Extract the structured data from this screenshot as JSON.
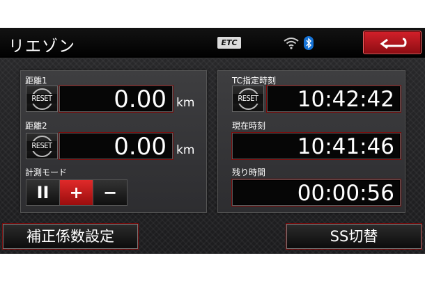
{
  "header": {
    "title": "リエゾン",
    "etc_badge": "ETC"
  },
  "left_panel": {
    "distance1": {
      "label": "距離1",
      "reset_label": "RESET",
      "value": "0.00",
      "unit": "km"
    },
    "distance2": {
      "label": "距離2",
      "reset_label": "RESET",
      "value": "0.00",
      "unit": "km"
    },
    "measure_mode": {
      "label": "計測モード",
      "buttons": [
        "II",
        "+",
        "−"
      ],
      "active": "+"
    }
  },
  "right_panel": {
    "tc_time": {
      "label": "TC指定時刻",
      "reset_label": "RESET",
      "value": "10:42:42"
    },
    "current_time": {
      "label": "現在時刻",
      "value": "10:41:46"
    },
    "remaining_time": {
      "label": "残り時間",
      "value": "00:00:56"
    }
  },
  "bottom": {
    "correction_label": "補正係数設定",
    "ss_switch_label": "SS切替"
  },
  "colors": {
    "accent_red": "#c4161d",
    "background": "#242426",
    "text": "#ffffff"
  }
}
